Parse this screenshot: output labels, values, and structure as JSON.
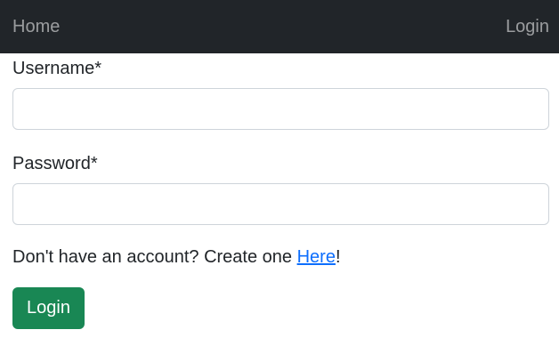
{
  "navbar": {
    "home_label": "Home",
    "login_label": "Login"
  },
  "form": {
    "username_label": "Username*",
    "username_value": "",
    "password_label": "Password*",
    "password_value": "",
    "signup_prefix": "Don't have an account? Create one ",
    "signup_link": "Here",
    "signup_suffix": "!",
    "submit_label": "Login"
  },
  "colors": {
    "navbar_bg": "#212529",
    "submit_bg": "#198754",
    "link": "#0d6efd"
  }
}
